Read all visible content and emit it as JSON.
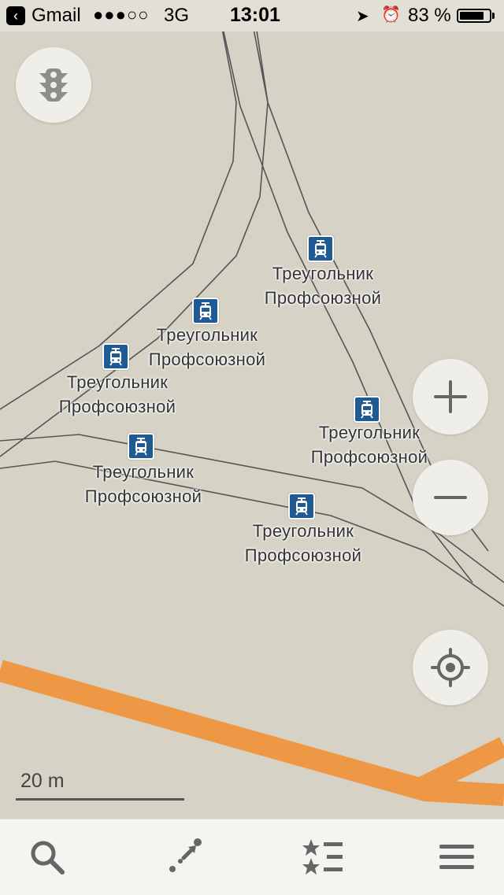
{
  "status_bar": {
    "back_app": "Gmail",
    "signal": "●●●○○",
    "network": "3G",
    "time": "13:01",
    "battery_percent": "83 %",
    "battery_level": 0.83,
    "icons": [
      "back-arrow-icon",
      "location-arrow-icon",
      "alarm-icon",
      "battery-icon"
    ]
  },
  "map": {
    "colors": {
      "background": "#d6d3c6",
      "road_major": "#ee9845",
      "tram_line": "#555555",
      "stop_icon": "#1f5a93"
    },
    "stops": [
      {
        "line1": "Треугольник",
        "line2": "Профсоюзной"
      },
      {
        "line1": "Треугольник",
        "line2": "Профсоюзной"
      },
      {
        "line1": "Треугольник",
        "line2": "Профсоюзной"
      },
      {
        "line1": "Треугольник",
        "line2": "Профсоюзной"
      },
      {
        "line1": "Треугольник",
        "line2": "Профсоюзной"
      },
      {
        "line1": "Треугольник",
        "line2": "Профсоюзной"
      }
    ],
    "scale_label": "20 m"
  },
  "controls": {
    "traffic": "traffic-light-icon",
    "zoom_in": "plus-icon",
    "zoom_out": "minus-icon",
    "my_location": "crosshair-icon"
  },
  "bottom_bar": {
    "items": [
      "search-icon",
      "route-icon",
      "bookmarks-icon",
      "menu-icon"
    ]
  }
}
